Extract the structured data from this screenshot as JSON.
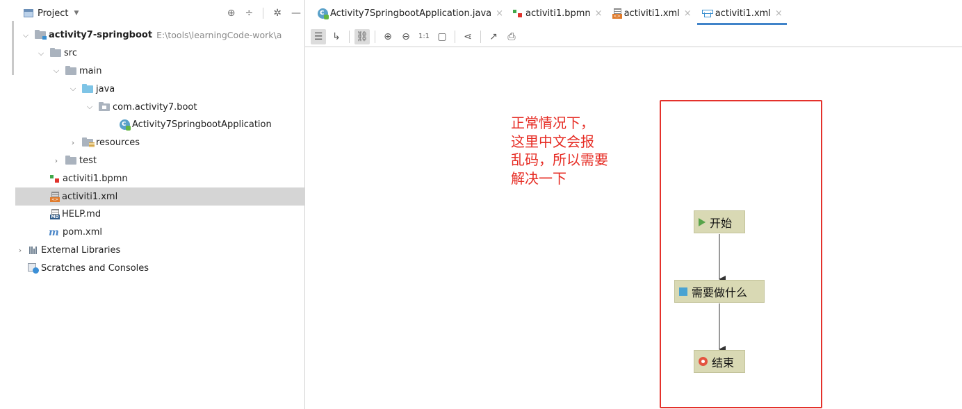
{
  "project_panel": {
    "title": "Project",
    "tree": [
      {
        "label": "activity7-springboot",
        "path": "E:\\tools\\learningCode-work\\a"
      },
      {
        "label": "src"
      },
      {
        "label": "main"
      },
      {
        "label": "java"
      },
      {
        "label": "com.activity7.boot"
      },
      {
        "label": "Activity7SpringbootApplication"
      },
      {
        "label": "resources"
      },
      {
        "label": "test"
      },
      {
        "label": "activiti1.bpmn"
      },
      {
        "label": "activiti1.xml"
      },
      {
        "label": "HELP.md"
      },
      {
        "label": "pom.xml"
      },
      {
        "label": "External Libraries"
      },
      {
        "label": "Scratches and Consoles"
      }
    ]
  },
  "tabs": [
    {
      "label": "Activity7SpringbootApplication.java"
    },
    {
      "label": "activiti1.bpmn"
    },
    {
      "label": "activiti1.xml"
    },
    {
      "label": "activiti1.xml"
    }
  ],
  "annotation": {
    "lines": [
      "正常情况下，",
      "这里中文会报",
      "乱码，所以需要",
      "解决一下"
    ]
  },
  "diagram": {
    "start": "开始",
    "task": "需要做什么",
    "end": "结束"
  },
  "colors": {
    "annotation": "#e62b23",
    "highlight_box": "#e4312b",
    "node_fill": "#d9d9b4",
    "active_tab_underline": "#4083c9"
  }
}
